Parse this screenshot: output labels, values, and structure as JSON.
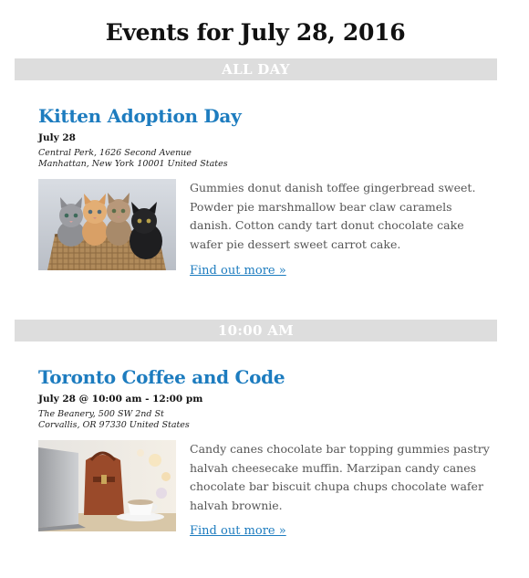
{
  "page": {
    "title": "Events for July 28, 2016"
  },
  "groups": [
    {
      "time_label": "ALL DAY",
      "event": {
        "title": "Kitten Adoption Day",
        "date": "July 28",
        "venue_line1": "Central Perk, 1626 Second Avenue",
        "venue_line2": "Manhattan, New York 10001 United States",
        "description": "Gummies donut danish toffee gingerbread sweet. Powder pie marshmallow bear claw caramels danish. Cotton candy tart donut chocolate cake wafer pie dessert sweet carrot cake.",
        "link_label": "Find out more »",
        "image": "kittens-photo"
      }
    },
    {
      "time_label": "10:00 AM",
      "event": {
        "title": "Toronto Coffee and Code",
        "date": "July 28 @ 10:00 am - 12:00 pm",
        "venue_line1": "The Beanery, 500 SW 2nd St",
        "venue_line2": "Corvallis, OR 97330 United States",
        "description": "Candy canes chocolate bar topping gummies pastry halvah cheesecake muffin. Marzipan candy canes chocolate bar biscuit chupa chups chocolate wafer halvah brownie.",
        "link_label": "Find out more »",
        "image": "laptop-coffee-photo"
      }
    }
  ],
  "colors": {
    "link": "#1d7cbf",
    "time_bar_bg": "#dddddd",
    "time_bar_text": "#ffffff",
    "body_text": "#555555"
  }
}
